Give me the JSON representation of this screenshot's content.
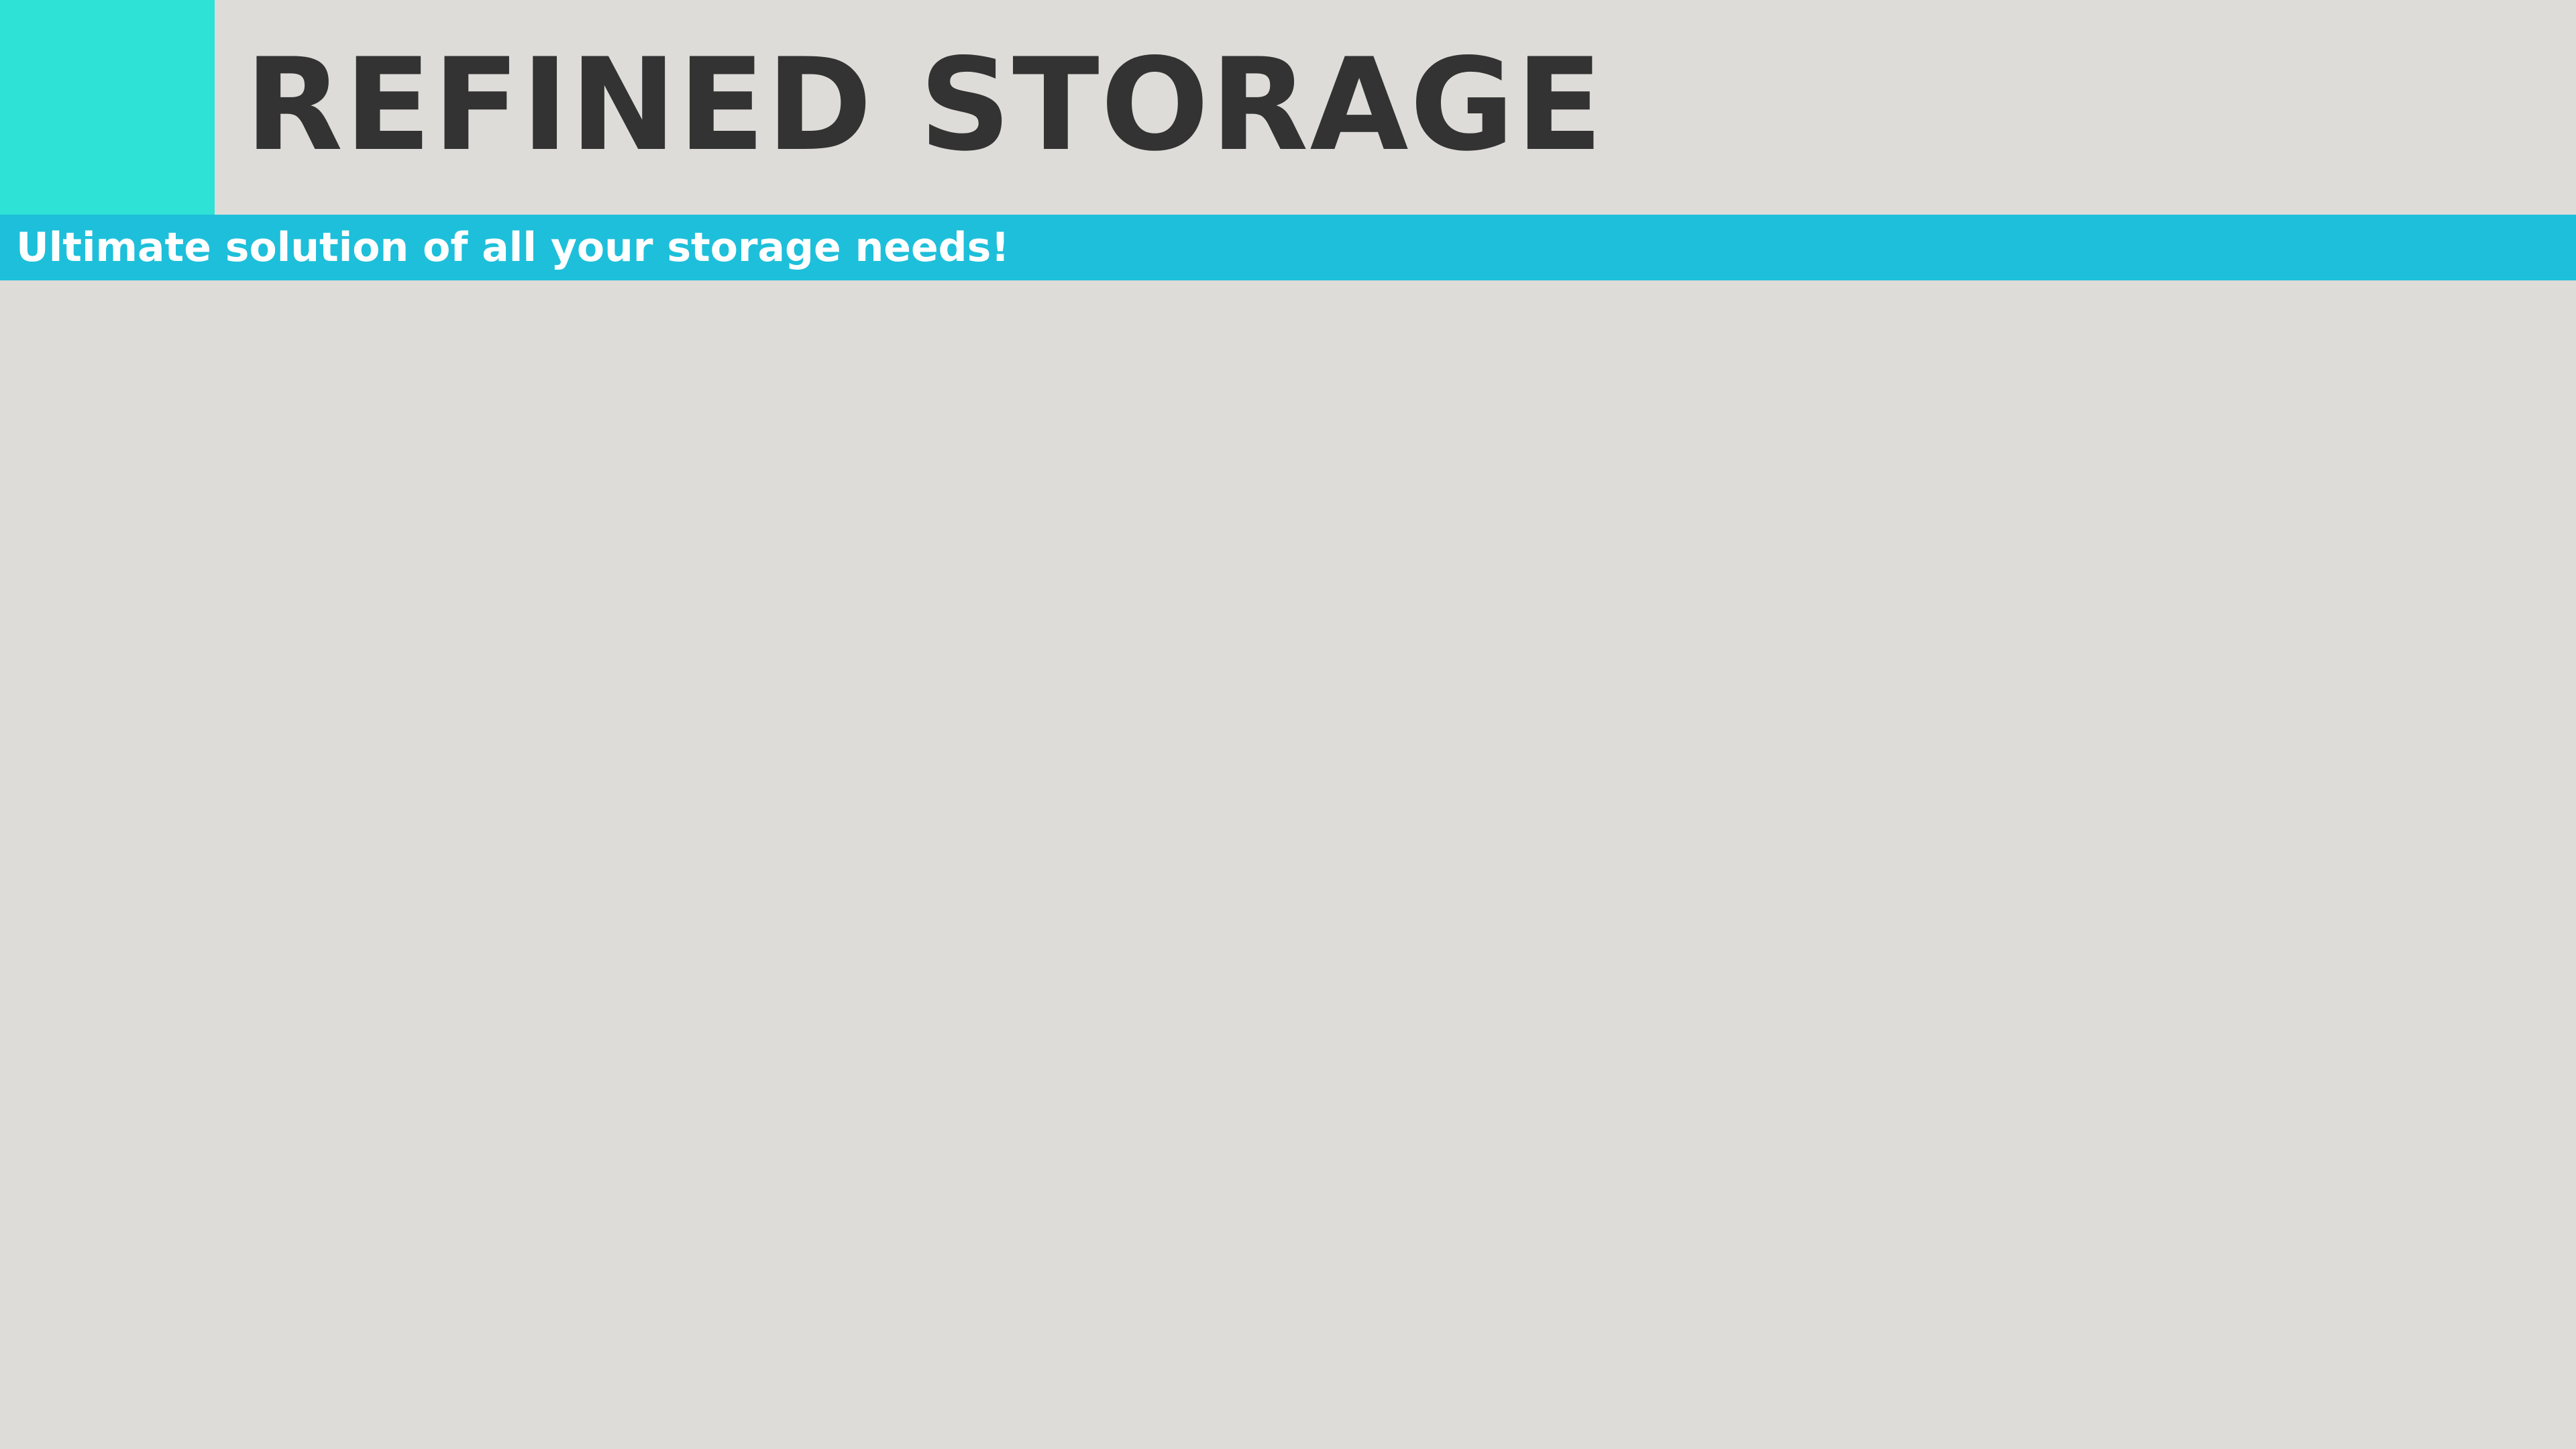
{
  "header": {
    "title": "REFINED STORAGE",
    "tagline": "Ultimate solution of all your storage needs!"
  },
  "colors": {
    "background": "#dedcd8",
    "accent_block": "#2ee2d6",
    "tagline_bar": "#1ebfda",
    "title_text": "#333333",
    "tagline_text": "#ffffff"
  }
}
